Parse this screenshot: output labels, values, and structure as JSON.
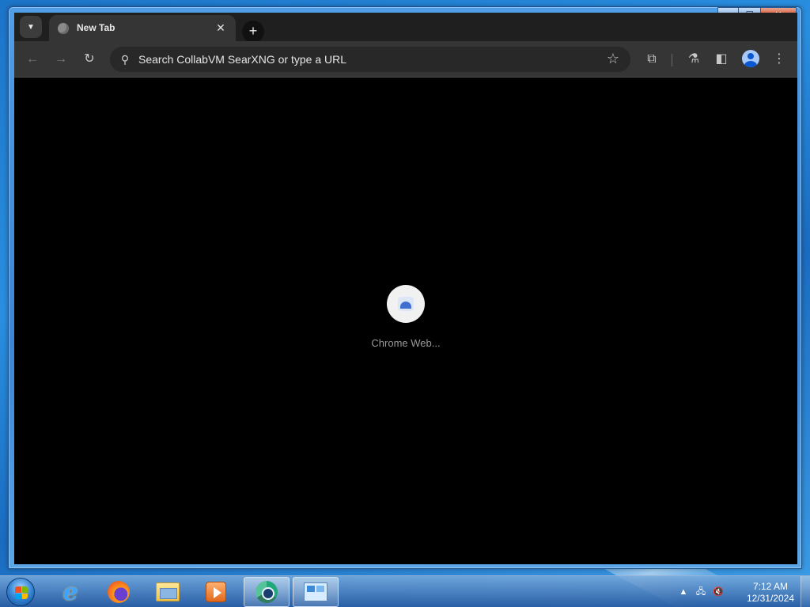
{
  "window": {
    "minimize_label": "▁",
    "maximize_label": "☐",
    "close_label": "✕"
  },
  "tabstrip": {
    "tab_search_icon": "chevron-down-icon",
    "tab_search_glyph": "▼",
    "tabs": [
      {
        "title": "New Tab",
        "favicon": "globe-icon",
        "close_glyph": "✕",
        "active": true
      }
    ],
    "new_tab_glyph": "+"
  },
  "toolbar": {
    "back_glyph": "←",
    "forward_glyph": "→",
    "reload_glyph": "↻",
    "omnibox": {
      "search_glyph": "⚲",
      "text": "Search CollabVM SearXNG or type a URL",
      "star_glyph": "☆"
    },
    "extensions_glyph": "⧉",
    "labs_glyph": "⚗",
    "side_panel_glyph": "◧",
    "menu_glyph": "⋮"
  },
  "content": {
    "shortcuts": [
      {
        "label": "Chrome Web..."
      }
    ]
  },
  "taskbar": {
    "apps": [
      {
        "name": "internet-explorer",
        "glyph": "e"
      },
      {
        "name": "firefox"
      },
      {
        "name": "file-explorer"
      },
      {
        "name": "media-player"
      },
      {
        "name": "chrome",
        "active": true
      },
      {
        "name": "control-panel",
        "active": true
      }
    ],
    "tray": {
      "show_hidden_glyph": "▲",
      "network_glyph": "🖧",
      "volume_glyph": "🔇"
    },
    "clock": {
      "time": "7:12 AM",
      "date": "12/31/2024"
    }
  },
  "colors": {
    "chrome_frame": "#1f1f1f",
    "toolbar": "#353535",
    "omnibox": "#282828",
    "content": "#000000",
    "accent": "#a8c7fa"
  }
}
